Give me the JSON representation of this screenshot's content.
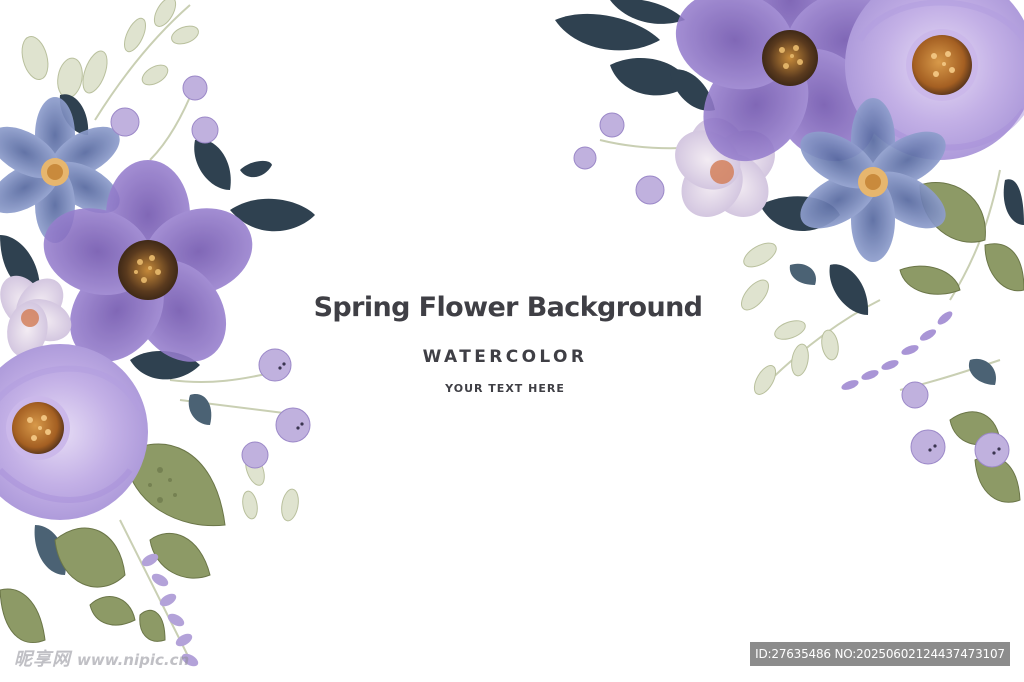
{
  "artwork": {
    "title": "Spring Flower Background",
    "subtitle": "WATERCOLOR",
    "tagline": "YOUR TEXT HERE"
  },
  "watermark": {
    "site_name": "昵享网",
    "site_url": "www.nipic.cn",
    "image_info": "ID:27635486 NO:20250602124437473107"
  },
  "palette": {
    "background": "#ffffff",
    "text": "#3f3f45",
    "lavender": "#a995d8",
    "purple": "#8e74c7",
    "blue_violet": "#7f93c8",
    "navy_leaf": "#2e3f52",
    "olive_leaf": "#8b9865",
    "flower_center": "#b86f2e"
  }
}
